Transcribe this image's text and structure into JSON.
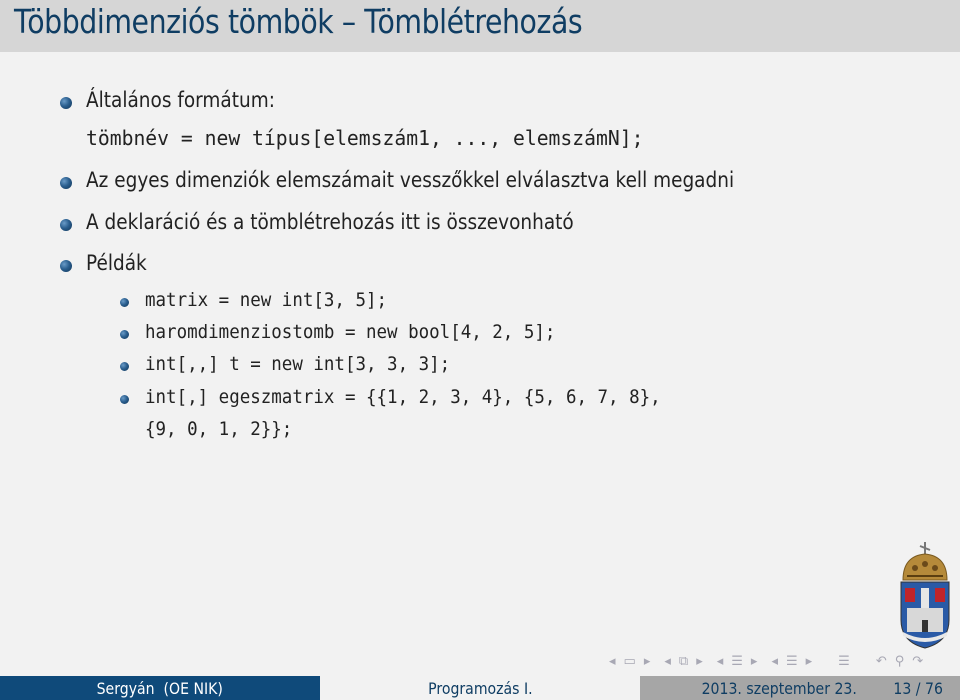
{
  "slide": {
    "title": "Többdimenziós tömbök – Tömblétrehozás"
  },
  "bullets": [
    {
      "text": "Általános formátum:",
      "code": "tömbnév = new típus[elemszám1, ..., elemszámN];"
    },
    {
      "text": "Az egyes dimenziók elemszámait vesszőkkel elválasztva kell megadni"
    },
    {
      "text": "A deklaráció és a tömblétrehozás itt is összevonható"
    },
    {
      "text": "Példák"
    }
  ],
  "examples": [
    "matrix = new int[3, 5];",
    "haromdimenziostomb = new bool[4, 2, 5];",
    "int[,,] t = new int[3, 3, 3];",
    "int[,] egeszmatrix = {{1, 2, 3, 4}, {5, 6, 7, 8},",
    "{9, 0, 1, 2}};"
  ],
  "navigation": {
    "icons": [
      "nav-prev-icon",
      "frame-icon",
      "nav-next-icon",
      "nav-prev-icon",
      "subsection-icon",
      "nav-next-icon",
      "nav-prev-icon",
      "section-icon",
      "nav-next-icon",
      "nav-prev-icon",
      "document-icon",
      "nav-next-icon",
      "appendix-icon",
      "back-icon",
      "search-icon",
      "forward-icon"
    ]
  },
  "footer": {
    "author": "Sergyán  (OE NIK)",
    "course": "Programozás I.",
    "date": "2013. szeptember 23.",
    "page": "13 / 76"
  },
  "colors": {
    "title": "#0f3d63",
    "footer_left": "#0f4a7a",
    "footer_right": "#a6a6a6",
    "title_bar": "#d6d6d6"
  }
}
